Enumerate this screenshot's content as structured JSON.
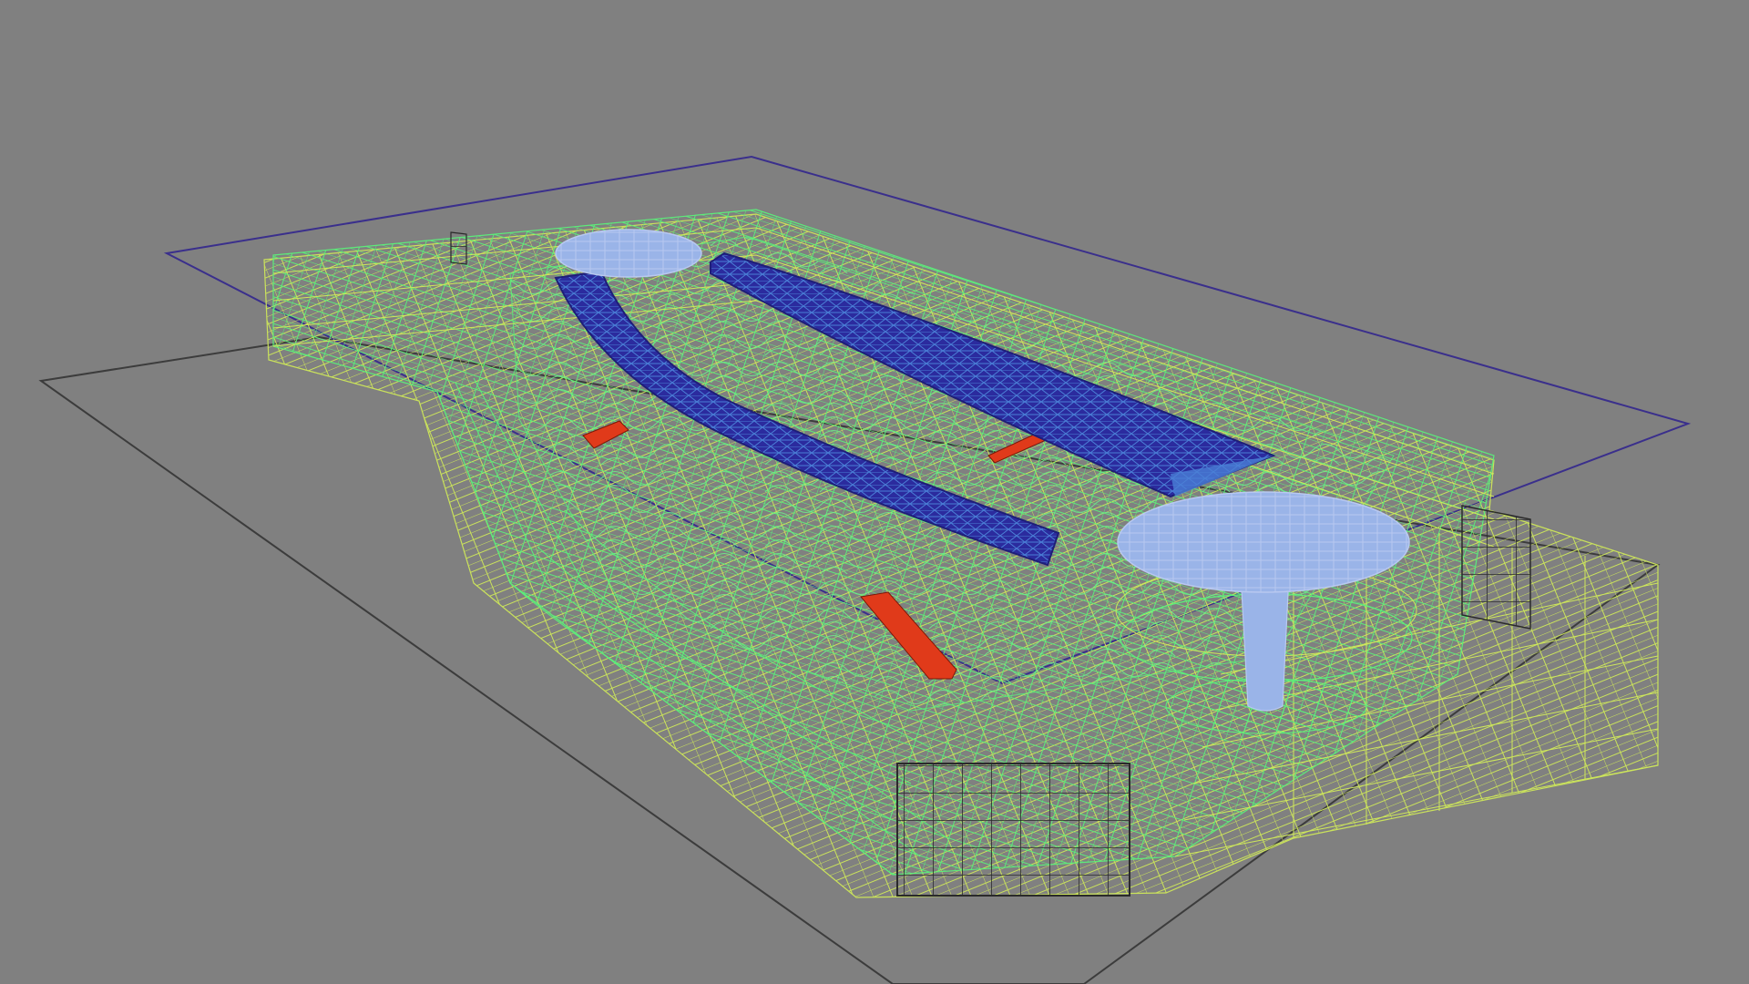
{
  "viewport": {
    "background_color": "#808080",
    "render_mode": "wireframe",
    "view": "perspective"
  },
  "scene": {
    "object_colors": {
      "ground_plane": "#3c3c3c",
      "site_boundary": "#3a2f8c",
      "building_wire_primary": "#5cf07a",
      "building_wire_secondary": "#cfe85a",
      "facade_grid": "#2a2a2a",
      "roof_truss": "#2b2b9e",
      "roof_truss_edge": "#4a7fd6",
      "drum_fill": "#9ab4e8",
      "drum_wire": "#b8c8f0",
      "accent_red": "#e03a1a"
    },
    "objects": [
      {
        "name": "ground-plane"
      },
      {
        "name": "site-boundary"
      },
      {
        "name": "building-mass"
      },
      {
        "name": "curved-roof-truss-left"
      },
      {
        "name": "curved-roof-truss-right"
      },
      {
        "name": "round-drum-small"
      },
      {
        "name": "round-drum-large"
      },
      {
        "name": "drum-column"
      },
      {
        "name": "facade-grid"
      },
      {
        "name": "stair-elements"
      }
    ]
  }
}
